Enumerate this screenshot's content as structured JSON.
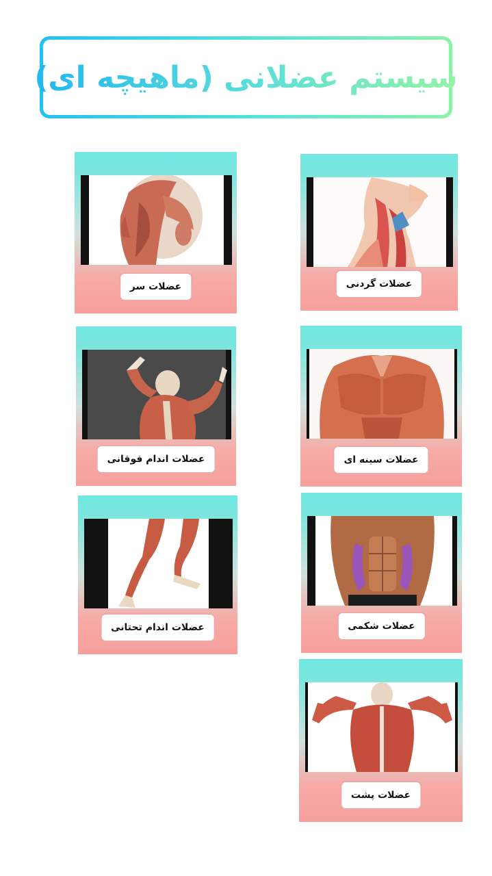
{
  "page": {
    "title": "سیستم عضلانی (ماهیچه ای)"
  },
  "colors": {
    "title_gradient_start": "#22b7f3",
    "title_gradient_end": "#96f2a6",
    "card_top": "#70e9e2",
    "card_bottom": "#f69f9c"
  },
  "cards": [
    {
      "label": "عضلات گردنی",
      "image": "neck-muscles-illustration"
    },
    {
      "label": "عضلات سر",
      "image": "head-muscles-illustration"
    },
    {
      "label": "عضلات سینه ای",
      "image": "chest-muscles-illustration"
    },
    {
      "label": "عضلات اندام فوقانی",
      "image": "upper-limb-muscles-illustration"
    },
    {
      "label": "عضلات شکمی",
      "image": "abdominal-muscles-illustration"
    },
    {
      "label": "عضلات اندام تحتانی",
      "image": "lower-limb-muscles-illustration"
    },
    {
      "label": "عضلات پشت",
      "image": "back-muscles-illustration"
    }
  ]
}
